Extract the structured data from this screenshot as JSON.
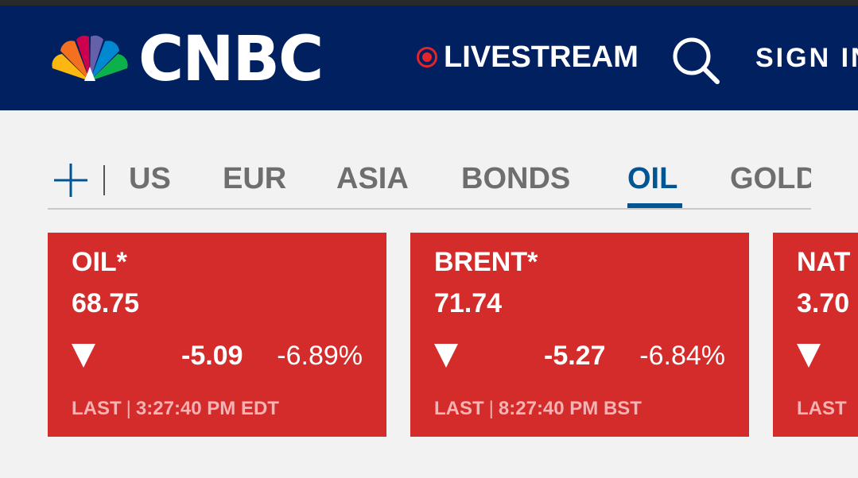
{
  "header": {
    "brand": "CNBC",
    "livestream_label": "LIVESTREAM",
    "signin_label": "SIGN IN",
    "colors": {
      "background": "#002060",
      "live_dot": "#e4242b"
    },
    "icons": [
      "peacock-logo-icon",
      "search-icon"
    ]
  },
  "tabs": {
    "add_icon": "plus-icon",
    "items": [
      {
        "label": "US",
        "active": false
      },
      {
        "label": "EUR",
        "active": false
      },
      {
        "label": "ASIA",
        "active": false
      },
      {
        "label": "BONDS",
        "active": false
      },
      {
        "label": "OIL",
        "active": true
      },
      {
        "label": "GOLD",
        "active": false
      }
    ],
    "colors": {
      "active": "#005594",
      "inactive": "#6e6e6e"
    }
  },
  "quotes": [
    {
      "symbol": "OIL*",
      "price": "68.75",
      "direction": "down",
      "change": "-5.09",
      "change_pct": "-6.89%",
      "last_label": "LAST",
      "time": "3:27:40 PM EDT"
    },
    {
      "symbol": "BRENT*",
      "price": "71.74",
      "direction": "down",
      "change": "-5.27",
      "change_pct": "-6.84%",
      "last_label": "LAST",
      "time": "8:27:40 PM BST"
    },
    {
      "symbol": "NAT",
      "price": "3.70",
      "direction": "down",
      "change": "",
      "change_pct": "",
      "last_label": "LAST",
      "time": ""
    }
  ],
  "colors": {
    "card_down": "#d42b2b"
  }
}
